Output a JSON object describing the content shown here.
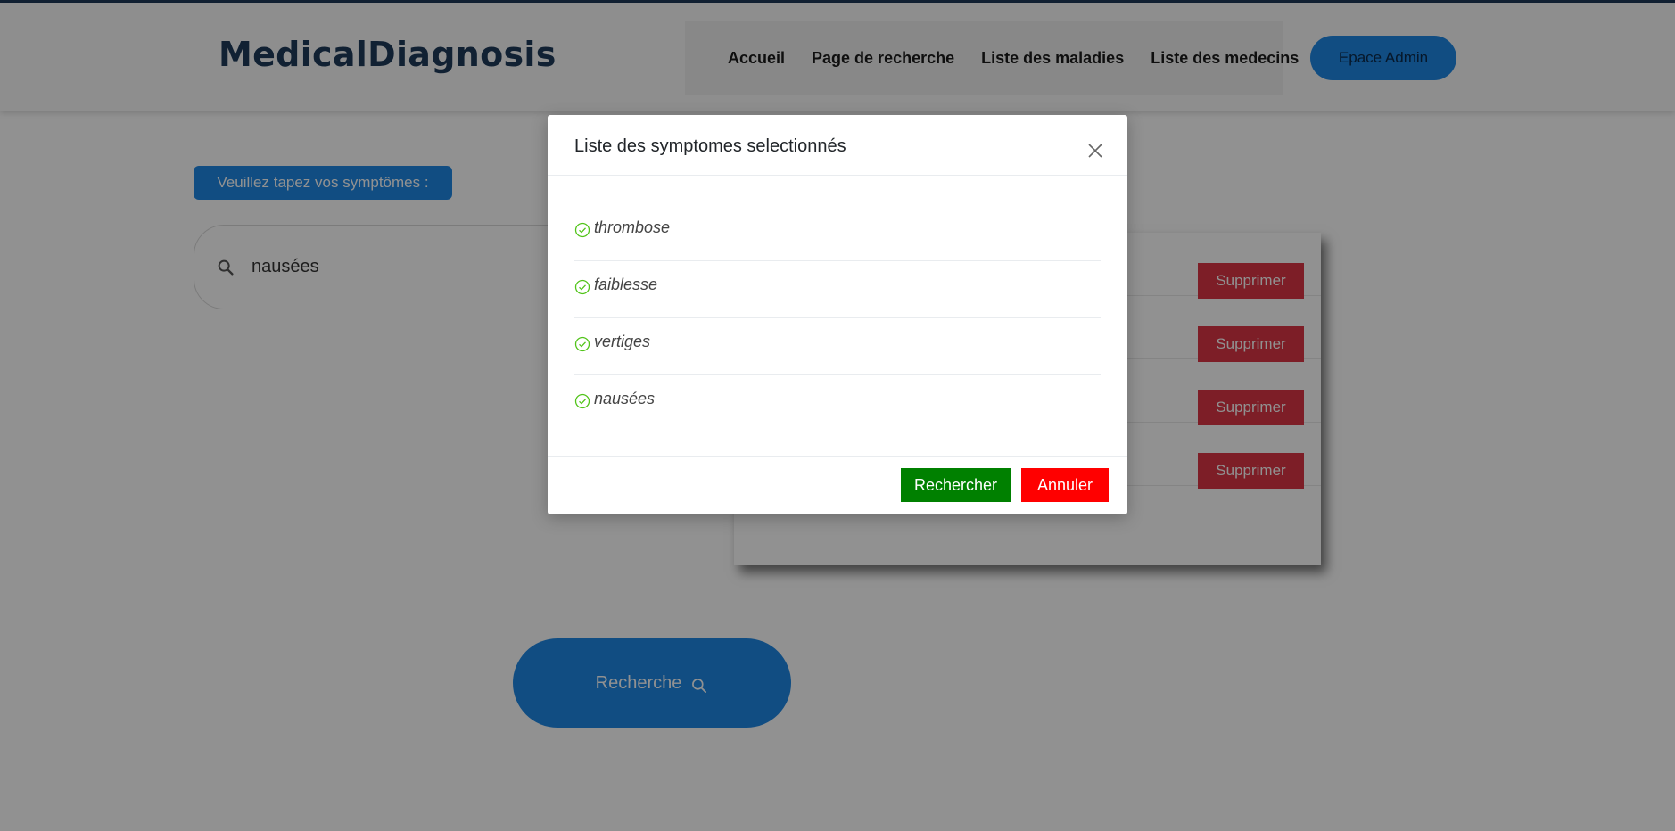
{
  "header": {
    "logo": "MedicalDiagnosis",
    "nav": [
      "Accueil",
      "Page de recherche",
      "Liste des maladies",
      "Liste des medecins"
    ],
    "admin_button": "Epace Admin"
  },
  "search": {
    "prompt": "Veuillez tapez vos symptômes :",
    "value": "nausées",
    "icon": "search-icon"
  },
  "selected_panel": {
    "delete_label": "Supprimer",
    "rows": 4
  },
  "main_button": {
    "label": "Recherche",
    "icon": "search-icon"
  },
  "modal": {
    "title": "Liste des symptomes selectionnés",
    "close_icon": "close-icon",
    "symptoms": [
      "thrombose",
      "faiblesse",
      "vertiges",
      "nausées"
    ],
    "check_icon": "check-circle-icon",
    "confirm_label": "Rechercher",
    "cancel_label": "Annuler"
  },
  "colors": {
    "brand": "#1f3a5a",
    "accent": "#1e88e5",
    "danger": "#dc3545",
    "confirm": "#008000",
    "cancel": "#ff0000",
    "check": "#52c41a"
  }
}
